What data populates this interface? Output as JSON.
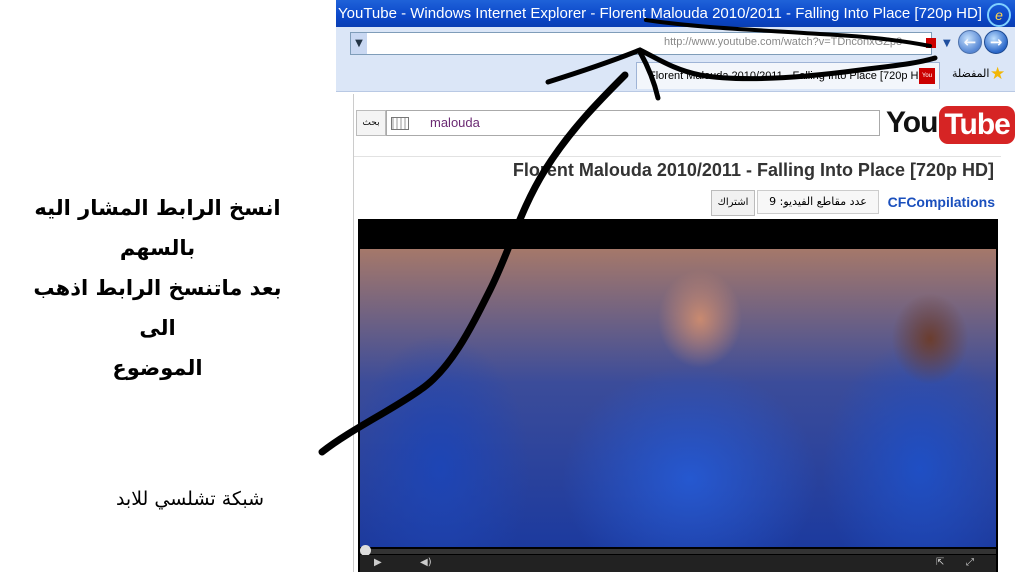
{
  "annotation": {
    "instruction_lines": [
      "انسخ الرابط المشار اليه بالسهم",
      "بعد ماتنسخ الرابط اذهب الى",
      "الموضوع"
    ],
    "footer": "شبكة تشلسي للابد"
  },
  "browser": {
    "window_title": "YouTube - Windows Internet Explorer - Florent Malouda 2010/2011 - Falling Into Place [720p HD]",
    "address_url": "http://www.youtube.com/watch?v=TDnconxGZp8",
    "tab_title": "Florent Malouda 2010/2011 - Falling Into Place [720p HD]",
    "favorites_label": "المفضلة",
    "icons": [
      "ie-logo-icon",
      "back-arrow-icon",
      "forward-arrow-icon",
      "star-icon",
      "youtube-favicon-icon"
    ]
  },
  "youtube": {
    "logo_you": "You",
    "logo_tube": "Tube",
    "search_button": "بحث",
    "search_query": "malouda",
    "video_title": "Florent Malouda 2010/2011 - Falling Into Place [720p HD]",
    "channel": "CFCompilations",
    "video_count_label": "عدد مقاطع الفيديو: 9",
    "subscribe_label": "اشتراك"
  },
  "colors": {
    "titlebar": "#0b47c9",
    "youtube_red": "#d62424",
    "channel_link": "#1a4fbd",
    "arrow": "#000000"
  }
}
